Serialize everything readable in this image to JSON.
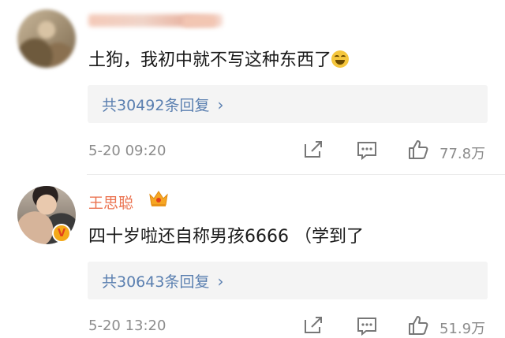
{
  "comments": [
    {
      "username": "",
      "text": "土狗，我初中就不写这种东西了",
      "emoji": "laughing-crying-emoji",
      "replies_label": "共30492条回复",
      "time": "5-20 09:20",
      "likes": "77.8万"
    },
    {
      "username": "王思聪",
      "badge": "crown-icon",
      "verified": "V",
      "text": "四十岁啦还自称男孩6666 （学到了",
      "replies_label": "共30643条回复",
      "time": "5-20 13:20",
      "likes": "51.9万"
    }
  ],
  "colors": {
    "username": "#eb7350",
    "link": "#5a7fb0",
    "meta": "#8c8c8c",
    "reply_bg": "#f4f4f4"
  }
}
